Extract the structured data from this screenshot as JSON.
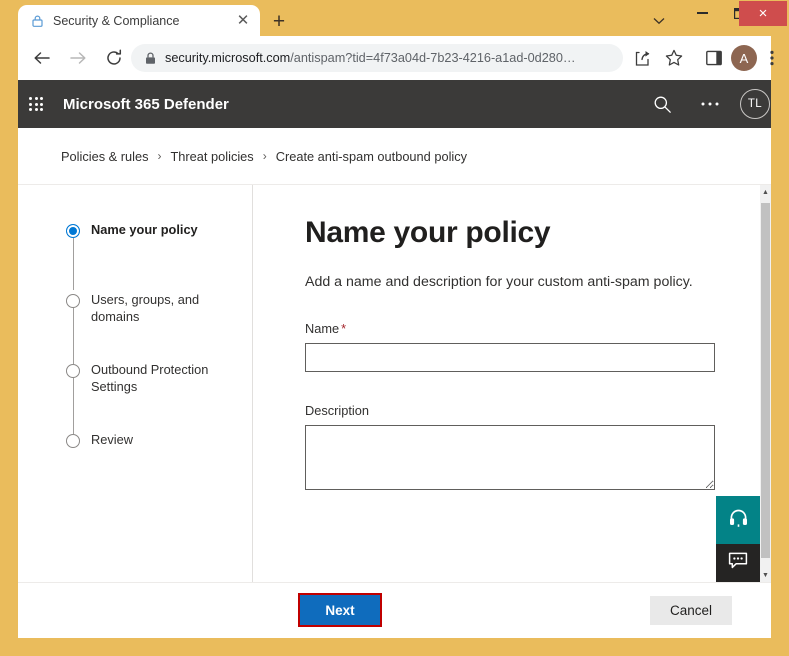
{
  "window": {
    "minimize_label": "–",
    "maximize_label": "☐",
    "close_label": "×",
    "close_color": "#cf4d4d",
    "frame_color": "#eabc5c"
  },
  "browser": {
    "tab": {
      "title": "Security & Compliance",
      "lock_icon": "lock-icon",
      "close_label": "✕"
    },
    "new_tab_label": "+",
    "tab_list_icon": "chevron-down-icon",
    "nav": {
      "back_icon": "back-arrow-icon",
      "forward_icon": "forward-arrow-icon",
      "reload_icon": "reload-icon"
    },
    "omnibox": {
      "lock_icon": "padlock-icon",
      "host": "security.microsoft.com",
      "path": "/antispam?tid=4f73a04d-7b23-4216-a1ad-0d280…",
      "full_url": "security.microsoft.com/antispam?tid=4f73a04d-7b23-4216-a1ad-0d280…"
    },
    "toolbar_icons": {
      "share": "share-icon",
      "bookmark": "star-icon",
      "sidebar": "reading-list-icon",
      "profile_initial": "A",
      "menu": "three-dot-menu-icon"
    }
  },
  "appbar": {
    "waffle_icon": "app-launcher-waffle-icon",
    "title": "Microsoft 365 Defender",
    "search_icon": "search-icon",
    "more_icon": "ellipsis-icon",
    "avatar_initials": "TL",
    "background": "#3b3a39"
  },
  "breadcrumb": {
    "items": [
      {
        "label": "Policies & rules"
      },
      {
        "label": "Threat policies"
      },
      {
        "label": "Create anti-spam outbound policy"
      }
    ],
    "separator": "›"
  },
  "wizard": {
    "steps": [
      {
        "label": "Name your policy",
        "state": "active"
      },
      {
        "label": "Users, groups, and domains",
        "state": "pending"
      },
      {
        "label": "Outbound Protection Settings",
        "state": "pending"
      },
      {
        "label": "Review",
        "state": "pending"
      }
    ],
    "active_color": "#0078d4"
  },
  "main": {
    "heading": "Name your policy",
    "intro": "Add a name and description for your custom anti-spam policy.",
    "name_field": {
      "label": "Name",
      "required_marker": "*",
      "value": "",
      "placeholder": ""
    },
    "description_field": {
      "label": "Description",
      "value": "",
      "placeholder": ""
    }
  },
  "side_rail": {
    "support": {
      "icon": "headset-icon",
      "color": "#038387"
    },
    "feedback": {
      "icon": "chat-bubble-icon",
      "color": "#252423"
    }
  },
  "scrollbar": {
    "up_arrow": "▲",
    "down_arrow": "▼"
  },
  "footer": {
    "next_label": "Next",
    "next_color": "#0f6cbd",
    "next_highlight_color": "#c00000",
    "cancel_label": "Cancel"
  }
}
